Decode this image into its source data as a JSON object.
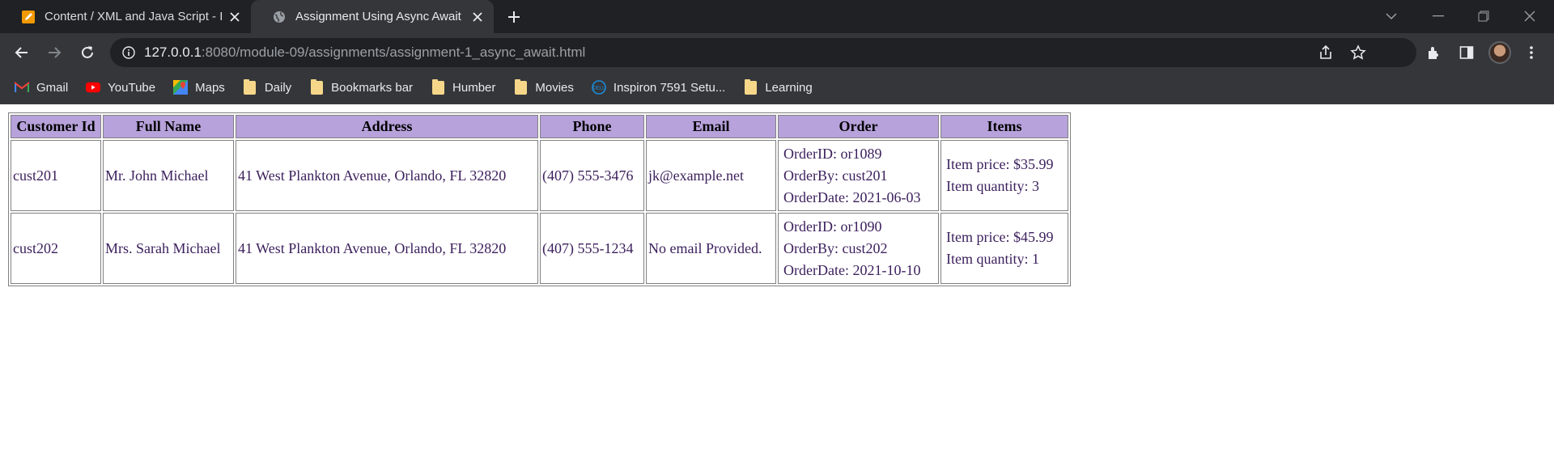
{
  "browser": {
    "tabs": [
      {
        "title": "Content / XML and Java Script - I",
        "favicon": "pencil-document-icon",
        "active": false
      },
      {
        "title": "Assignment Using Async Await",
        "favicon": "globe-icon",
        "active": true
      }
    ],
    "address": {
      "host": "127.0.0.1",
      "rest": ":8080/module-09/assignments/assignment-1_async_await.html"
    },
    "bookmarks": [
      {
        "label": "Gmail",
        "icon": "gmail-icon"
      },
      {
        "label": "YouTube",
        "icon": "youtube-icon"
      },
      {
        "label": "Maps",
        "icon": "maps-icon"
      },
      {
        "label": "Daily",
        "icon": "folder-icon"
      },
      {
        "label": "Bookmarks bar",
        "icon": "folder-icon"
      },
      {
        "label": "Humber",
        "icon": "folder-icon"
      },
      {
        "label": "Movies",
        "icon": "folder-icon"
      },
      {
        "label": "Inspiron 7591 Setu...",
        "icon": "dell-icon"
      },
      {
        "label": "Learning",
        "icon": "folder-icon"
      }
    ]
  },
  "table": {
    "headers": [
      "Customer Id",
      "Full Name",
      "Address",
      "Phone",
      "Email",
      "Order",
      "Items"
    ],
    "rows": [
      {
        "customer_id": "cust201",
        "full_name": "Mr. John Michael",
        "address": "41 West Plankton Avenue, Orlando, FL 32820",
        "phone": "(407) 555-3476",
        "email": "jk@example.net",
        "order_id": "OrderID: or1089",
        "order_by": "OrderBy: cust201",
        "order_date": "OrderDate: 2021-06-03",
        "item_price": "Item price: $35.99",
        "item_quantity": "Item quantity: 3"
      },
      {
        "customer_id": "cust202",
        "full_name": "Mrs. Sarah Michael",
        "address": "41 West Plankton Avenue, Orlando, FL 32820",
        "phone": "(407) 555-1234",
        "email": "No email Provided.",
        "order_id": "OrderID: or1090",
        "order_by": "OrderBy: cust202",
        "order_date": "OrderDate: 2021-10-10",
        "item_price": "Item price: $45.99",
        "item_quantity": "Item quantity: 1"
      }
    ]
  },
  "colors": {
    "header_bg": "#b7a2db",
    "cell_text": "#3b1f5c",
    "chrome_dark": "#202124",
    "chrome_mid": "#35363a"
  }
}
